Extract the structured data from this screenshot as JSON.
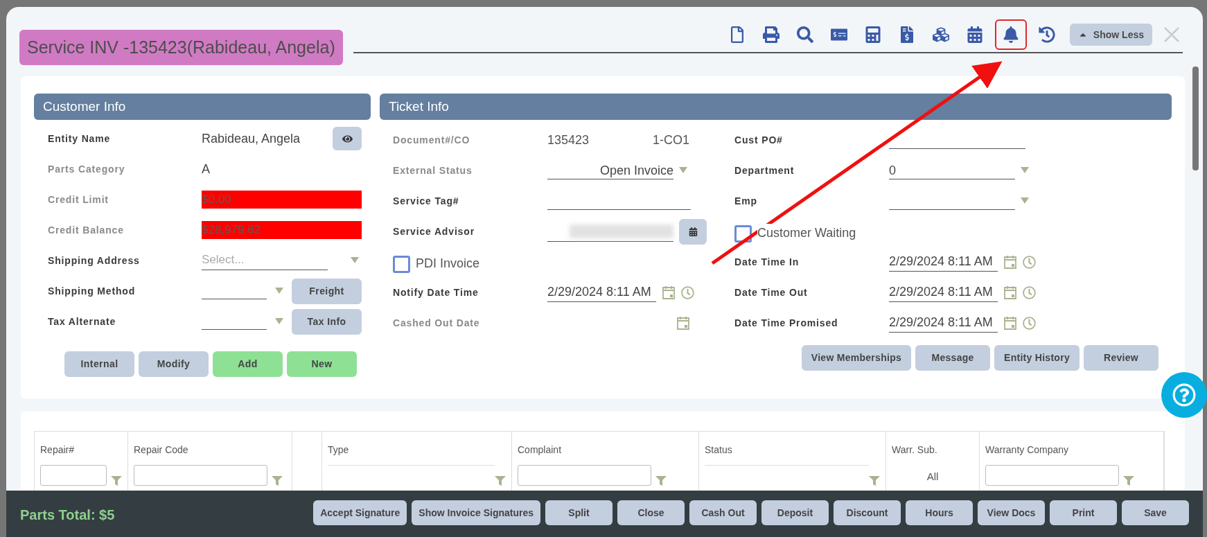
{
  "title": "Service INV -135423(Rabideau, Angela)",
  "toolbar": {
    "icons": [
      {
        "kind": "document",
        "highlighted": false
      },
      {
        "kind": "print",
        "highlighted": false
      },
      {
        "kind": "search",
        "highlighted": false
      },
      {
        "kind": "check",
        "highlighted": false
      },
      {
        "kind": "calculator",
        "highlighted": false
      },
      {
        "kind": "invoice",
        "highlighted": false
      },
      {
        "kind": "boxes",
        "highlighted": false
      },
      {
        "kind": "calendar",
        "highlighted": false
      },
      {
        "kind": "bell",
        "highlighted": true
      },
      {
        "kind": "history",
        "highlighted": false
      }
    ],
    "show_less": "Show Less"
  },
  "customer_info": {
    "heading": "Customer Info",
    "fields": [
      {
        "kind": "text",
        "label": "Entity Name",
        "readonly": false,
        "value": "Rabideau, Angela",
        "eye": true
      },
      {
        "kind": "text",
        "label": "Parts Category",
        "readonly": true,
        "value": "A"
      },
      {
        "kind": "alert",
        "label": "Credit Limit",
        "readonly": true,
        "value": "$0.00"
      },
      {
        "kind": "alert",
        "label": "Credit Balance",
        "readonly": true,
        "value": "$28,979.62"
      },
      {
        "kind": "select",
        "label": "Shipping Address",
        "readonly": false,
        "placeholder": "Select..."
      },
      {
        "kind": "select_button",
        "label": "Shipping Method",
        "readonly": false,
        "button": "Freight"
      },
      {
        "kind": "select_button",
        "label": "Tax Alternate",
        "readonly": false,
        "button": "Tax Info"
      }
    ],
    "buttons": [
      {
        "label": "Internal",
        "color": "#c3cfdf"
      },
      {
        "label": "Modify",
        "color": "#c3cfdf"
      },
      {
        "label": "Add",
        "color": "#8ee095"
      },
      {
        "label": "New",
        "color": "#8ee095"
      }
    ]
  },
  "ticket_info": {
    "heading": "Ticket Info",
    "left": [
      {
        "kind": "pair",
        "label": "Document#/CO",
        "readonly": true,
        "value": "135423",
        "value_2": "1-CO1"
      },
      {
        "kind": "select",
        "label": "External Status",
        "readonly": true,
        "value": "Open Invoice",
        "right_aligned": true
      },
      {
        "kind": "input",
        "label": "Service Tag#",
        "readonly": false
      },
      {
        "kind": "blurred",
        "label": "Service Advisor",
        "readonly": false
      },
      {
        "kind": "checkbox",
        "label": "PDI Invoice",
        "checked": false
      },
      {
        "kind": "datetime",
        "label": "Notify Date Time",
        "readonly": false,
        "value": "2/29/2024 8:11 AM"
      },
      {
        "kind": "date",
        "label": "Cashed Out Date",
        "readonly": true
      }
    ],
    "right": [
      {
        "kind": "input",
        "label": "Cust PO#",
        "readonly": false
      },
      {
        "kind": "select",
        "label": "Department",
        "readonly": false,
        "value": "0"
      },
      {
        "kind": "select",
        "label": "Emp",
        "readonly": false
      },
      {
        "kind": "checkbox",
        "label": "Customer Waiting",
        "checked": false
      },
      {
        "kind": "datetime",
        "label": "Date Time In",
        "readonly": false,
        "value": "2/29/2024 8:11 AM"
      },
      {
        "kind": "datetime",
        "label": "Date Time Out",
        "readonly": false,
        "value": "2/29/2024 8:11 AM"
      },
      {
        "kind": "datetime",
        "label": "Date Time Promised",
        "readonly": false,
        "value": "2/29/2024 8:11 AM"
      }
    ],
    "buttons": [
      "View Memberships",
      "Message",
      "Entity History",
      "Review"
    ]
  },
  "repairs_table": {
    "columns": [
      {
        "label": "Repair#",
        "kind": "input"
      },
      {
        "label": "Repair Code",
        "kind": "input"
      },
      {
        "kind": "none"
      },
      {
        "label": "Type",
        "kind": "select"
      },
      {
        "label": "Complaint",
        "kind": "input"
      },
      {
        "label": "Status",
        "kind": "select"
      },
      {
        "label": "Warr. Sub.",
        "kind": "text",
        "filter_value": "All"
      },
      {
        "label": "Warranty Company",
        "kind": "input"
      }
    ]
  },
  "footer": {
    "parts_total": "Parts Total: $5",
    "buttons": [
      "Accept Signature",
      "Show Invoice Signatures",
      "Split",
      "Close",
      "Cash Out",
      "Deposit",
      "Discount",
      "Hours",
      "View Docs",
      "Print",
      "Save"
    ]
  }
}
